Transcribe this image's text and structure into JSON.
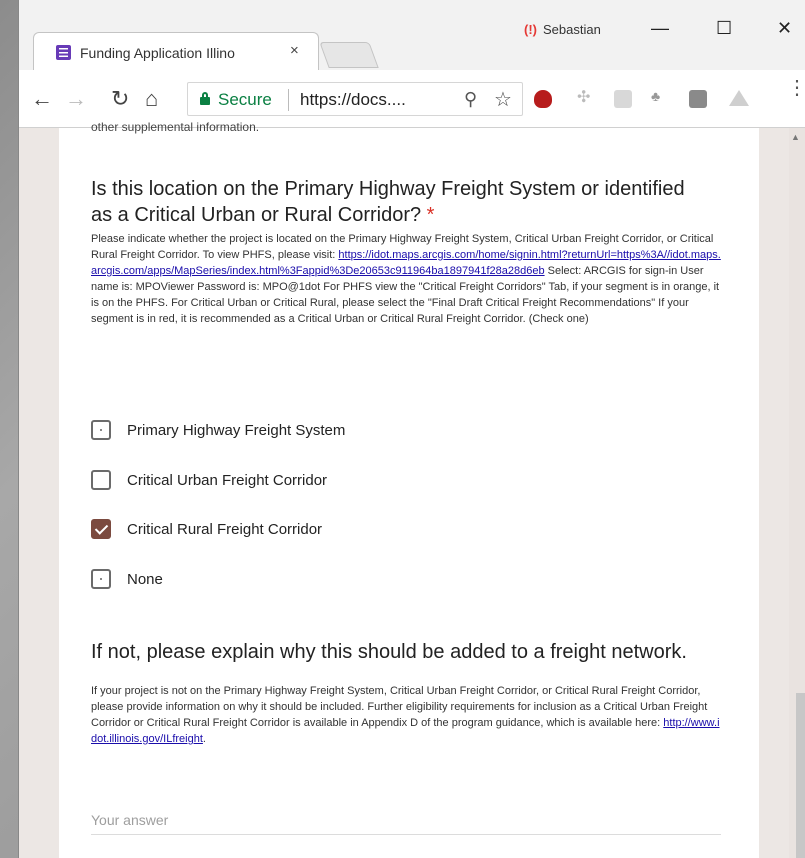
{
  "browser": {
    "tab_title": "Funding Application Illino",
    "tab_close": "×",
    "user_name": "Sebastian",
    "secure_label": "Secure",
    "url": "https://docs....",
    "minimize": "—",
    "maximize": "☐",
    "close": "✕"
  },
  "form": {
    "cut_text": "other supplemental information.",
    "q1": {
      "title": "Is this location on the Primary Highway Freight System or identified as a Critical Urban or Rural Corridor?",
      "required_mark": "*",
      "desc_before_link": "Please indicate whether the project is located on the Primary Highway Freight System, Critical Urban Freight Corridor, or Critical Rural Freight Corridor. To view PHFS, please visit: ",
      "link": "https://idot.maps.arcgis.com/home/signin.html?returnUrl=https%3A//idot.maps.arcgis.com/apps/MapSeries/index.html%3Fappid%3De20653c911964ba1897941f28a28d6eb",
      "desc_after_link": " Select: ARCGIS for sign-in User name is: MPOViewer Password is: MPO@1dot For PHFS view the \"Critical Freight Corridors\" Tab, if your segment is in orange, it is on the PHFS. For Critical Urban or Critical Rural, please select the \"Final Draft Critical Freight Recommendations\" If your segment is in red, it is recommended as a Critical Urban or Critical Rural Freight Corridor. (Check one)",
      "options": [
        {
          "label": "Primary Highway Freight System",
          "checked": false
        },
        {
          "label": "Critical Urban Freight Corridor",
          "checked": false
        },
        {
          "label": "Critical Rural Freight Corridor",
          "checked": true
        },
        {
          "label": "None",
          "checked": false
        }
      ]
    },
    "q2": {
      "title": "If not, please explain why this should be added to a freight network.",
      "desc": "If your project is not on the Primary Highway Freight System, Critical Urban Freight Corridor, or Critical Rural Freight Corridor, please provide information on why it should be included. Further eligibility requirements for inclusion as a Critical Urban Freight Corridor or Critical Rural Freight Corridor is available in Appendix D of the program guidance, which is available here: ",
      "link": "http://www.idot.illinois.gov/ILfreight",
      "link_suffix": ".",
      "answer_placeholder": "Your answer"
    }
  },
  "colors": {
    "accent": "#7b4a3f",
    "secure": "#0b8043",
    "required": "#d93025"
  },
  "icons": [
    "forms-favicon",
    "back-icon",
    "forward-icon",
    "reload-icon",
    "home-icon",
    "lock-icon",
    "zoom-icon",
    "star-icon",
    "ublock-icon",
    "dropbox-icon",
    "grammarly-icon",
    "extension-icon",
    "pocket-icon",
    "drive-icon",
    "menu-icon"
  ]
}
